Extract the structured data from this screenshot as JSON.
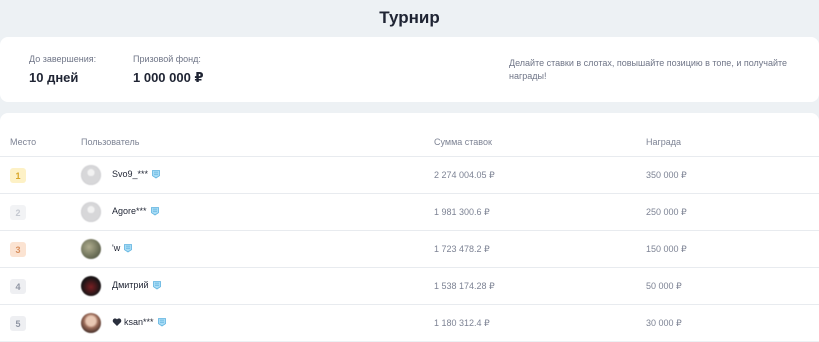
{
  "header": {
    "title": "Турнир"
  },
  "info": {
    "stats": [
      {
        "label": "До завершения:",
        "value": "10 дней"
      },
      {
        "label": "Призовой фонд:",
        "value": "1 000 000 ₽"
      }
    ],
    "description": "Делайте ставки в слотах, повышайте позицию в топе, и получайте награды!"
  },
  "table": {
    "columns": {
      "place": "Место",
      "user": "Пользователь",
      "sum": "Сумма ставок",
      "prize": "Награда"
    },
    "rows": [
      {
        "place": "1",
        "user": "Svo9_***",
        "sum": "2 274 004.05 ₽",
        "prize": "350 000 ₽",
        "badge_bg": "#fdf1c6",
        "badge_fg": "#d8a629",
        "avatar": "placeholder",
        "heart": false
      },
      {
        "place": "2",
        "user": "Agore***",
        "sum": "1 981 300.6 ₽",
        "prize": "250 000 ₽",
        "badge_bg": "#f2f3f5",
        "badge_fg": "#c5c9d1",
        "avatar": "placeholder",
        "heart": false
      },
      {
        "place": "3",
        "user": "'w",
        "sum": "1 723 478.2 ₽",
        "prize": "150 000 ₽",
        "badge_bg": "#fbe3d2",
        "badge_fg": "#d9905f",
        "avatar": "photo-olive",
        "heart": false
      },
      {
        "place": "4",
        "user": "Дмитрий",
        "sum": "1 538 174.28 ₽",
        "prize": "50 000 ₽",
        "badge_bg": "#eeeff2",
        "badge_fg": "#8f95a3",
        "avatar": "photo-dark",
        "heart": false
      },
      {
        "place": "5",
        "user": "ksan***",
        "sum": "1 180 312.4 ₽",
        "prize": "30 000 ₽",
        "badge_bg": "#eeeff2",
        "badge_fg": "#8f95a3",
        "avatar": "photo-portrait",
        "heart": true
      }
    ]
  },
  "icons": {
    "level": "level-badge-icon",
    "heart": "heart-icon"
  },
  "colors": {
    "accent_badge": "#7ec4ea",
    "background": "#edf1f4"
  }
}
